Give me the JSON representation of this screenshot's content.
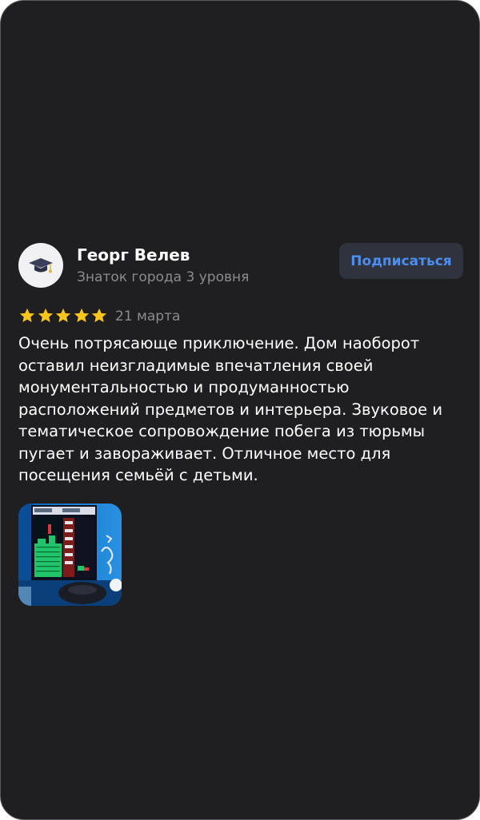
{
  "review": {
    "author_name": "Георг Велев",
    "author_level": "Знаток города 3 уровня",
    "subscribe_label": "Подписаться",
    "rating": 5,
    "rating_max": 5,
    "date": "21 марта",
    "text_lines": [
      "Очень потрясающе приключение. Дом наоборот",
      "оставил неизгладимые впечатления своей",
      "монументальностью и продуманностью",
      "расположений предметов и интерьера. Звуковое и",
      "тематическое сопровождение побега из тюрьмы",
      "пугает и завораживает. Отличное место для",
      "посещения семьёй с детьми."
    ],
    "avatar_icon": "graduation-cap-icon",
    "star_icon": "star-icon",
    "photo_count": 1
  },
  "colors": {
    "card_background": "#1f1f21",
    "text_primary": "#ffffff",
    "text_secondary": "#8b8b90",
    "button_background": "#2f333d",
    "button_text": "#4d8df0",
    "star": "#f8c51c"
  }
}
